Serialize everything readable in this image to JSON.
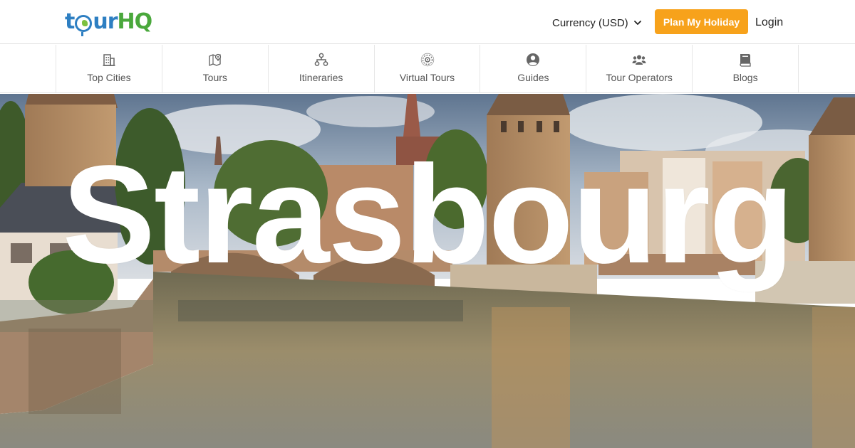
{
  "header": {
    "logo": {
      "part1": "t",
      "part2": "ur",
      "part3": "HQ",
      "alt": "tourHQ"
    },
    "currency_label": "Currency (USD)",
    "plan_button": "Plan My Holiday",
    "login": "Login"
  },
  "nav": {
    "items": [
      {
        "label": "Top Cities",
        "icon": "building-icon"
      },
      {
        "label": "Tours",
        "icon": "map-pin-icon"
      },
      {
        "label": "Itineraries",
        "icon": "network-icon"
      },
      {
        "label": "Virtual Tours",
        "icon": "virtual-tour-icon"
      },
      {
        "label": "Guides",
        "icon": "user-circle-icon"
      },
      {
        "label": "Tour Operators",
        "icon": "users-icon"
      },
      {
        "label": "Blogs",
        "icon": "book-icon"
      }
    ]
  },
  "hero": {
    "title": "Strasbourg"
  },
  "colors": {
    "accent": "#f7a21b",
    "logo_blue": "#2e7fc2",
    "logo_green": "#4aa83c",
    "nav_icon": "#666666"
  }
}
